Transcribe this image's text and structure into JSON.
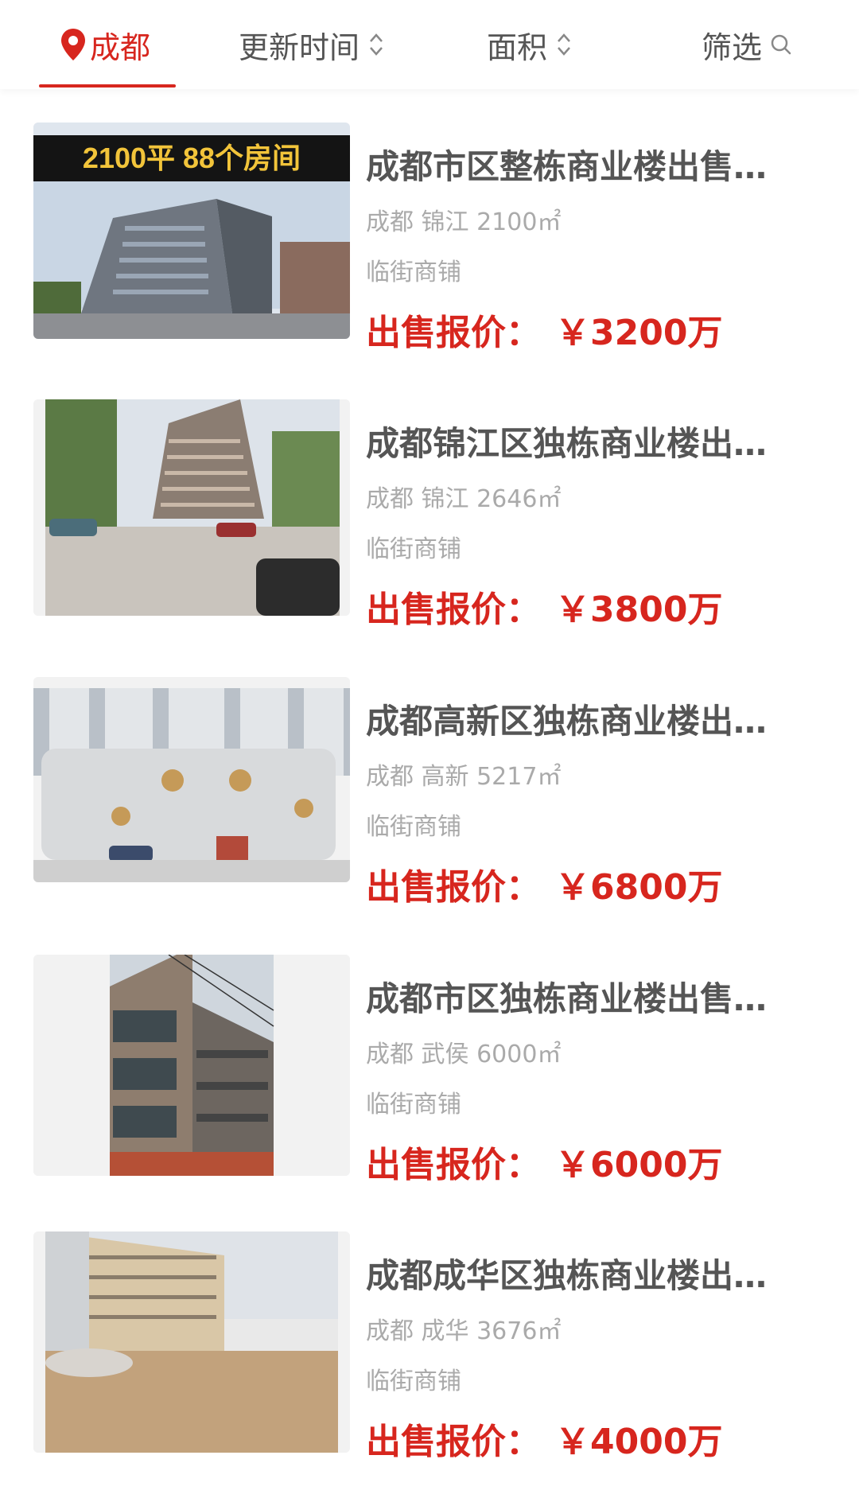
{
  "filters": {
    "city": "成都",
    "update_time": "更新时间",
    "area": "面积",
    "screen": "筛选"
  },
  "listings": [
    {
      "title": "成都市区整栋商业楼出售…",
      "city": "成都",
      "district": "锦江",
      "size": "2100㎡",
      "tag": "临街商铺",
      "price_label": "出售报价：",
      "price": "￥3200万",
      "banner": "2100平 88个房间"
    },
    {
      "title": "成都锦江区独栋商业楼出…",
      "city": "成都",
      "district": "锦江",
      "size": "2646㎡",
      "tag": "临街商铺",
      "price_label": "出售报价：",
      "price": "￥3800万"
    },
    {
      "title": "成都高新区独栋商业楼出…",
      "city": "成都",
      "district": "高新",
      "size": "5217㎡",
      "tag": "临街商铺",
      "price_label": "出售报价：",
      "price": "￥6800万"
    },
    {
      "title": "成都市区独栋商业楼出售…",
      "city": "成都",
      "district": "武侯",
      "size": "6000㎡",
      "tag": "临街商铺",
      "price_label": "出售报价：",
      "price": "￥6000万"
    },
    {
      "title": "成都成华区独栋商业楼出…",
      "city": "成都",
      "district": "成华",
      "size": "3676㎡",
      "tag": "临街商铺",
      "price_label": "出售报价：",
      "price": "￥4000万"
    }
  ],
  "colors": {
    "accent": "#d7261e",
    "title": "#555555",
    "meta": "#aaaaaa"
  },
  "icons": {
    "city": "location-pin-icon",
    "sort": "sort-updown-icon",
    "filter": "search-icon"
  }
}
